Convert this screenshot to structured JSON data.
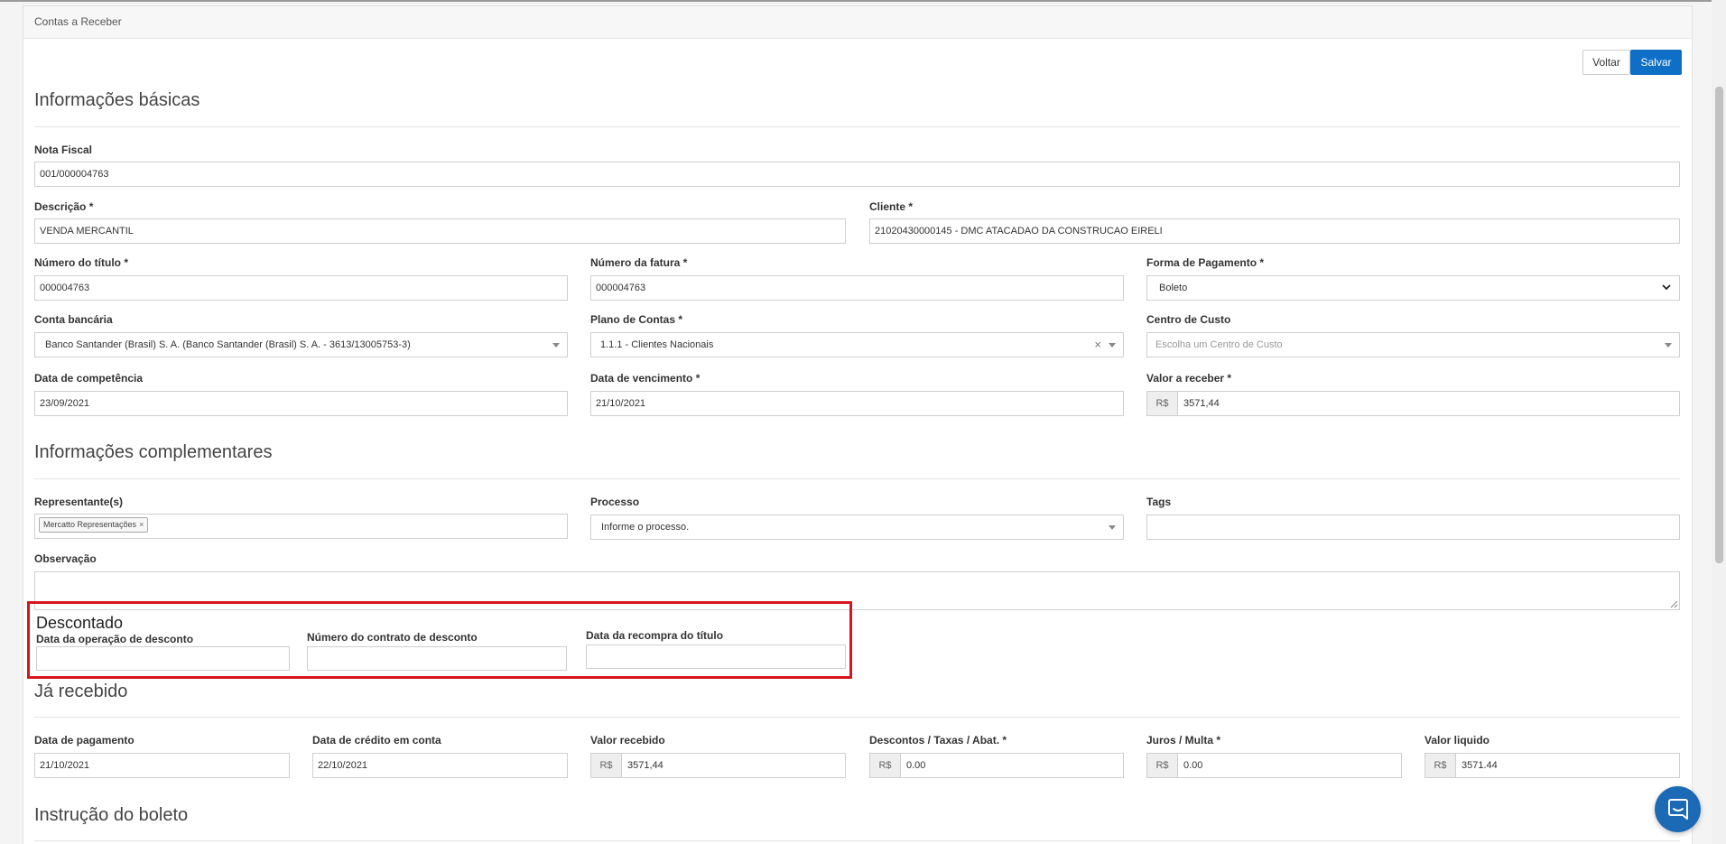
{
  "breadcrumb": "Contas a Receber",
  "buttons": {
    "voltar": "Voltar",
    "salvar": "Salvar"
  },
  "sections": {
    "basic": "Informações básicas",
    "complementary": "Informações complementares",
    "discounted": "Descontado",
    "received": "Já recebido",
    "boleto": "Instrução do boleto"
  },
  "basic": {
    "nota_fiscal": {
      "label": "Nota Fiscal",
      "value": "001/000004763"
    },
    "descricao": {
      "label": "Descrição *",
      "value": "VENDA MERCANTIL"
    },
    "cliente": {
      "label": "Cliente *",
      "value": "21020430000145 - DMC ATACADAO DA CONSTRUCAO EIRELI"
    },
    "numero_titulo": {
      "label": "Número do título *",
      "value": "000004763"
    },
    "numero_fatura": {
      "label": "Número da fatura *",
      "value": "000004763"
    },
    "forma_pagamento": {
      "label": "Forma de Pagamento *",
      "value": "Boleto"
    },
    "conta_bancaria": {
      "label": "Conta bancária",
      "value": "Banco Santander (Brasil) S. A. (Banco Santander (Brasil) S. A. - 3613/13005753-3)"
    },
    "plano_contas": {
      "label": "Plano de Contas *",
      "value": "1.1.1 - Clientes Nacionais"
    },
    "centro_custo": {
      "label": "Centro de Custo",
      "placeholder": "Escolha um Centro de Custo"
    },
    "data_competencia": {
      "label": "Data de competência",
      "value": "23/09/2021"
    },
    "data_vencimento": {
      "label": "Data de vencimento *",
      "value": "21/10/2021"
    },
    "valor_receber": {
      "label": "Valor a receber *",
      "currency": "R$",
      "value": "3571,44"
    }
  },
  "complementary": {
    "representantes": {
      "label": "Representante(s)",
      "chip": "Mercatto Representações",
      "chip_remove": "×"
    },
    "processo": {
      "label": "Processo",
      "placeholder": "Informe o processo."
    },
    "tags": {
      "label": "Tags",
      "value": ""
    },
    "observacao": {
      "label": "Observação",
      "value": ""
    }
  },
  "discounted": {
    "data_operacao": {
      "label": "Data da operação de desconto",
      "value": ""
    },
    "numero_contrato": {
      "label": "Número do contrato de desconto",
      "value": ""
    },
    "data_recompra": {
      "label": "Data da recompra do título",
      "value": ""
    }
  },
  "received": {
    "data_pagamento": {
      "label": "Data de pagamento",
      "value": "21/10/2021"
    },
    "data_credito": {
      "label": "Data de crédito em conta",
      "value": "22/10/2021"
    },
    "valor_recebido": {
      "label": "Valor recebido",
      "currency": "R$",
      "value": "3571,44"
    },
    "descontos": {
      "label": "Descontos / Taxas / Abat. *",
      "currency": "R$",
      "value": "0.00"
    },
    "juros": {
      "label": "Juros / Multa *",
      "currency": "R$",
      "value": "0.00"
    },
    "valor_liquido": {
      "label": "Valor liquido",
      "currency": "R$",
      "value": "3571.44"
    }
  },
  "colors": {
    "primary": "#0f6fc6",
    "highlight_border": "#d7151e",
    "chat": "#1c6ab5"
  },
  "icons": [
    "chevron-down-icon",
    "caret-down-icon",
    "clear-icon",
    "resize-handle-icon",
    "chat-icon"
  ]
}
